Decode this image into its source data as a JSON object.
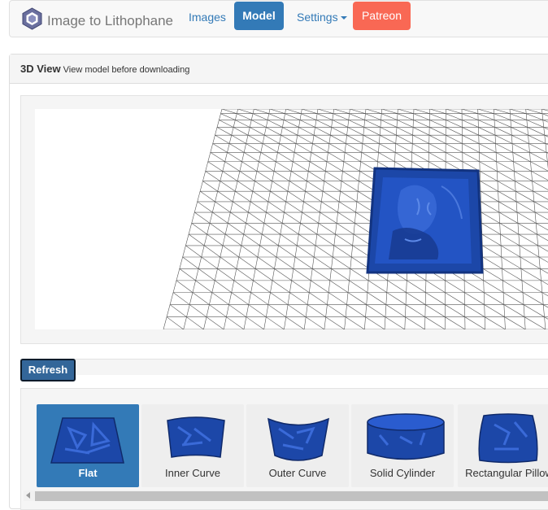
{
  "navbar": {
    "brand": "Image to Lithophane",
    "links": {
      "images": "Images",
      "model": "Model",
      "settings": "Settings",
      "patreon": "Patreon"
    }
  },
  "panel": {
    "title": "3D View",
    "subtitle": "View model before downloading"
  },
  "viewer": {
    "refresh_label": "Refresh"
  },
  "shapes": [
    {
      "label": "Flat",
      "selected": true
    },
    {
      "label": "Inner Curve",
      "selected": false
    },
    {
      "label": "Outer Curve",
      "selected": false
    },
    {
      "label": "Solid Cylinder",
      "selected": false
    },
    {
      "label": "Rectangular Pillow",
      "selected": false
    }
  ],
  "colors": {
    "primary": "#337ab7",
    "patreon": "#f96854",
    "model": "#1c47a8",
    "refresh": "#336699"
  },
  "icons": [
    "cube-logo-icon",
    "caret-down-icon",
    "scroll-left-arrow-icon"
  ]
}
